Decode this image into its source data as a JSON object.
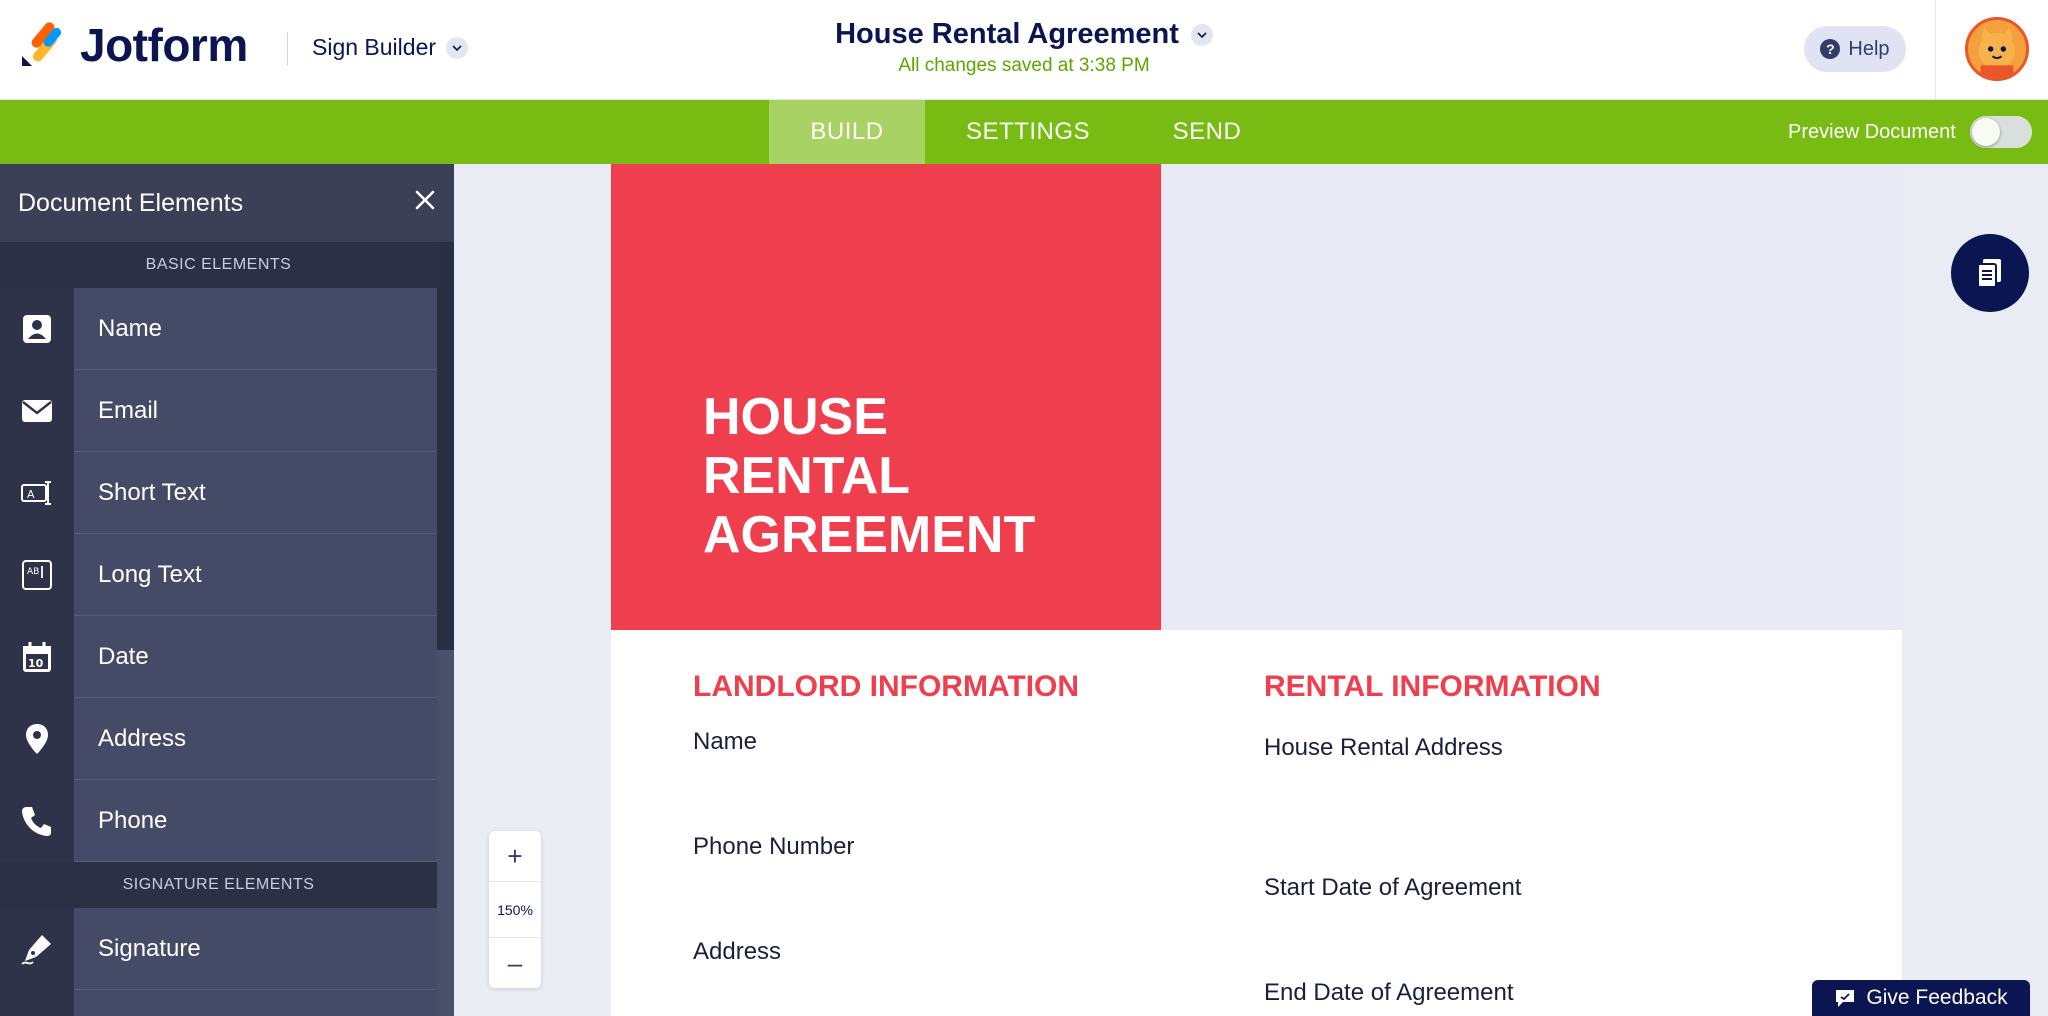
{
  "header": {
    "brand": "Jotform",
    "builder_label": "Sign Builder",
    "document_title": "House Rental Agreement",
    "saved_status": "All changes saved at 3:38 PM",
    "help_label": "Help"
  },
  "nav": {
    "tabs": [
      {
        "label": "BUILD",
        "active": true
      },
      {
        "label": "SETTINGS",
        "active": false
      },
      {
        "label": "SEND",
        "active": false
      }
    ],
    "preview_label": "Preview Document",
    "preview_enabled": false
  },
  "sidebar": {
    "title": "Document Elements",
    "basic_section": "BASIC ELEMENTS",
    "items": [
      {
        "label": "Name",
        "icon": "person-card-icon"
      },
      {
        "label": "Email",
        "icon": "envelope-icon"
      },
      {
        "label": "Short Text",
        "icon": "short-text-icon"
      },
      {
        "label": "Long Text",
        "icon": "long-text-icon"
      },
      {
        "label": "Date",
        "icon": "calendar-icon"
      },
      {
        "label": "Address",
        "icon": "map-pin-icon"
      },
      {
        "label": "Phone",
        "icon": "phone-icon"
      }
    ],
    "signature_section": "SIGNATURE ELEMENTS",
    "signature_items": [
      {
        "label": "Signature",
        "icon": "signature-pen-icon"
      }
    ]
  },
  "document": {
    "hero_title_lines": [
      "HOUSE",
      "RENTAL",
      "AGREEMENT"
    ],
    "landlord": {
      "title": "LANDLORD INFORMATION",
      "fields": [
        "Name",
        "Phone Number",
        "Address"
      ]
    },
    "rental": {
      "title": "RENTAL INFORMATION",
      "fields": [
        "House Rental Address",
        "Start Date of Agreement",
        "End Date of Agreement"
      ]
    }
  },
  "zoom": {
    "plus": "+",
    "level": "150%",
    "minus": "–"
  },
  "feedback_label": "Give Feedback",
  "colors": {
    "brand_navy": "#0a1551",
    "nav_green": "#78bb12",
    "accent_red": "#ef3f4e",
    "saved_green": "#5ca700"
  }
}
